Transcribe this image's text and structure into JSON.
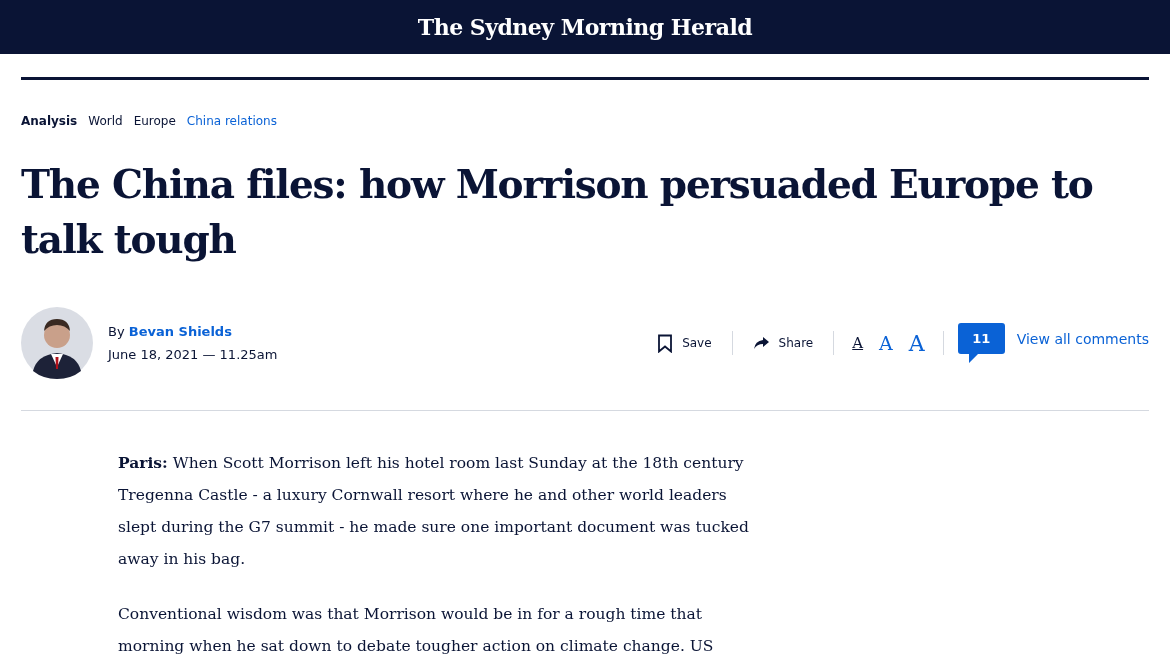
{
  "masthead": {
    "title": "The Sydney Morning Herald"
  },
  "breadcrumbs": [
    {
      "label": "Analysis",
      "kind": "label"
    },
    {
      "label": "World",
      "kind": "section"
    },
    {
      "label": "Europe",
      "kind": "section"
    },
    {
      "label": "China relations",
      "kind": "topic"
    }
  ],
  "headline": "The China files: how Morrison persuaded Europe to talk tough",
  "byline": {
    "prefix": "By",
    "author": "Bevan Shields",
    "date": "June 18, 2021 — 11.25am"
  },
  "actions": {
    "save": "Save",
    "share": "Share",
    "font_sizes": [
      {
        "label": "A",
        "selected": true
      },
      {
        "label": "A",
        "selected": false
      },
      {
        "label": "A",
        "selected": false
      }
    ],
    "comment_count": "11",
    "comments_link": "View all comments"
  },
  "paragraphs": [
    "**Paris:** When Scott Morrison left his hotel room last Sunday at the 18th century Tregenna Castle - a luxury Cornwall resort where he and other world leaders slept during the G7 summit - he made sure one important document was tucked away in his bag.",
    "Conventional wisdom was that Morrison would be in for a rough time that morning when he sat down to debate tougher action on climate change. US"
  ]
}
